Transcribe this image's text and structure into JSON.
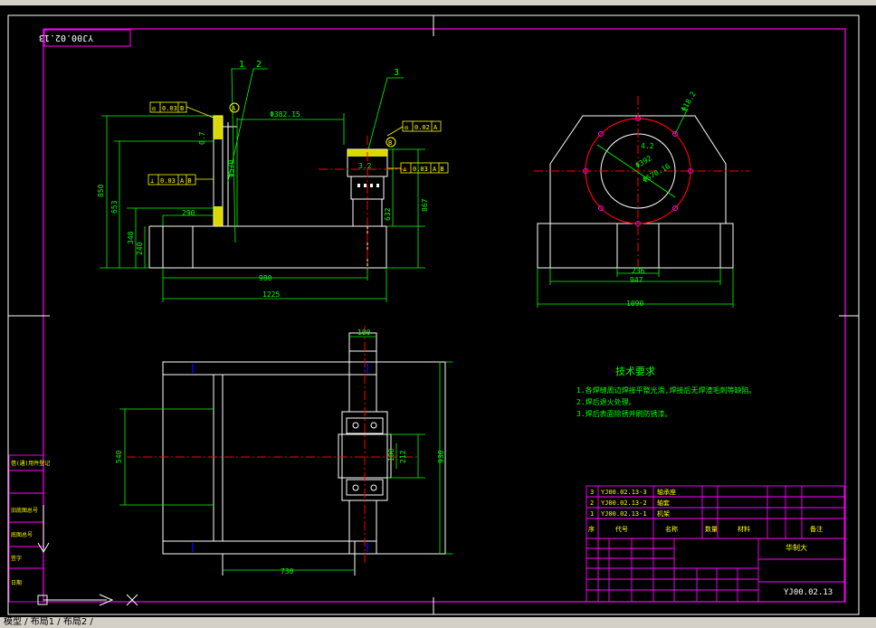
{
  "drawing": {
    "number_top": "YJ00.02.13",
    "number_bottom": "YJ00.02.13",
    "company": "华制大"
  },
  "colors": {
    "background": "#000000",
    "border": "#ff00ff",
    "geometry": "#ffffff",
    "dimension": "#00ff00",
    "center": "#ff0000",
    "hidden": "#0000ff",
    "hatch": "#ffff00",
    "annotation": "#ffff00",
    "text_green": "#00ff00"
  },
  "callouts": [
    "1",
    "2",
    "3"
  ],
  "datum_labels": [
    "A",
    "B"
  ],
  "tolerances": [
    {
      "symbol": "◎",
      "value": "0.03",
      "datum": "B"
    },
    {
      "symbol": "◎",
      "value": "0.02",
      "datum": "A"
    },
    {
      "symbol": "⊥",
      "value": "0.03",
      "datum": "A B"
    },
    {
      "symbol": "⊥",
      "value": "0.03",
      "datum": "A B"
    }
  ],
  "front_dims": {
    "d6382": "Φ382.15",
    "d570": "Φ570",
    "r0_7": "0.7",
    "h850": "850",
    "h653": "653",
    "w290": "290",
    "h348": "348",
    "h240": "240",
    "w980": "980",
    "w1225": "1225",
    "h632": "632",
    "h867": "867",
    "r3_2": "3.2"
  },
  "side_dims": {
    "holes": "Φ18.2",
    "w236": "236",
    "w947": "947",
    "w1090": "1090",
    "r4_2": "4.2",
    "d392": "Φ392",
    "d570b": "Φ570.16"
  },
  "plan_dims": {
    "w100": "100",
    "h540": "540",
    "h212": "212",
    "h930": "930",
    "h100b": "100",
    "w730": "730"
  },
  "tech": {
    "title": "技术要求",
    "items": [
      "1.各焊缝周边焊接平整光滑,焊接后无焊渣毛刺等缺陷。",
      "2.焊后退火处理。",
      "3.焊后表面除锈并刷防锈漆。"
    ]
  },
  "parts": [
    {
      "no": "3",
      "code": "YJ00.02.13-3",
      "name": "轴承座"
    },
    {
      "no": "2",
      "code": "YJ00.02.13-2",
      "name": "轴套"
    },
    {
      "no": "1",
      "code": "YJ00.02.13-1",
      "name": "机架"
    }
  ],
  "bom_header": [
    "序",
    "代号",
    "名称",
    "数量",
    "材料",
    "备注"
  ],
  "left_labels": [
    "借(通)用件登记",
    "旧底图总号",
    "底图总号",
    "签字",
    "日期"
  ],
  "status_text": "模型 / 布局1 / 布局2 /"
}
